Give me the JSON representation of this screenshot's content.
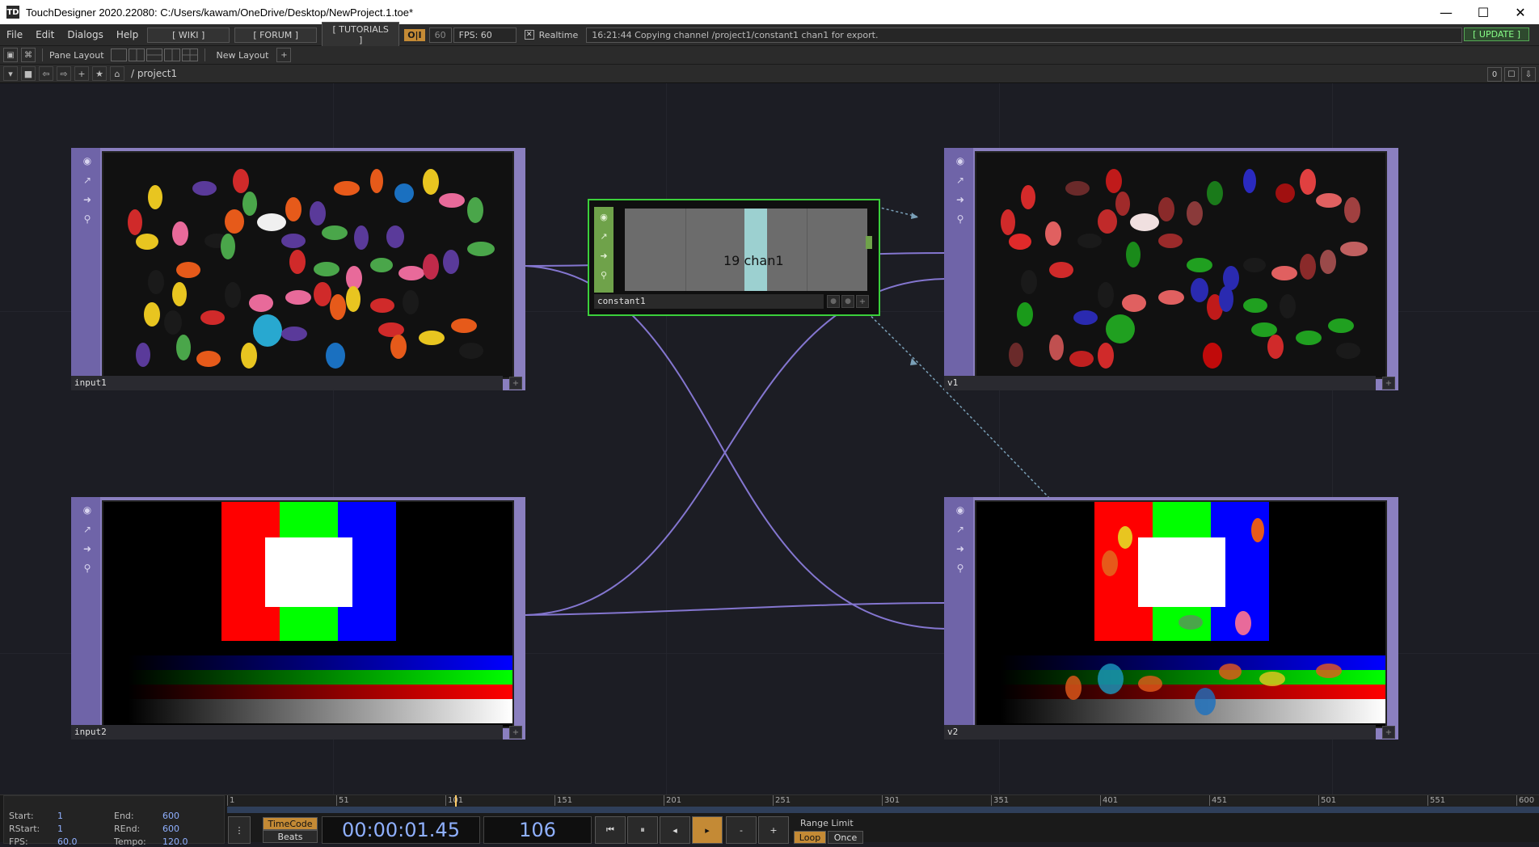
{
  "window": {
    "title": "TouchDesigner 2020.22080: C:/Users/kawam/OneDrive/Desktop/NewProject.1.toe*",
    "app_icon_text": "TD",
    "controls": {
      "minimize": "—",
      "maximize": "☐",
      "close": "✕"
    }
  },
  "menu": {
    "items": [
      "File",
      "Edit",
      "Dialogs",
      "Help"
    ],
    "wiki": "[ WIKI ]",
    "forum": "[ FORUM ]",
    "tutorials": "[ TUTORIALS ]",
    "oi": "O|I",
    "fps_limit": "60",
    "fps": "FPS: 60",
    "realtime_check": "✕",
    "realtime": "Realtime",
    "status": "16:21:44 Copying channel /project1/constant1 chan1 for export.",
    "update": "[ UPDATE ]"
  },
  "toolbar": {
    "pane_layout": "Pane Layout",
    "new_layout": "New Layout",
    "add": "+"
  },
  "pathbar": {
    "path": "/ project1",
    "counter": "0"
  },
  "nodes": {
    "input1": {
      "label": "input1"
    },
    "input2": {
      "label": "input2"
    },
    "v1": {
      "label": "v1"
    },
    "v2": {
      "label": "v2"
    },
    "constant1": {
      "label": "constant1",
      "value": "19",
      "channel": "chan1"
    }
  },
  "timeline": {
    "start_label": "Start:",
    "start": "1",
    "end_label": "End:",
    "end": "600",
    "rstart_label": "RStart:",
    "rstart": "1",
    "rend_label": "REnd:",
    "rend": "600",
    "fps_label": "FPS:",
    "fps": "60.0",
    "tempo_label": "Tempo:",
    "tempo": "120.0",
    "ticks": [
      "1",
      "51",
      "101",
      "151",
      "201",
      "251",
      "301",
      "351",
      "401",
      "451",
      "501",
      "551",
      "600"
    ],
    "timecode_btn": "TimeCode",
    "beats_btn": "Beats",
    "timecode": "00:00:01.45",
    "frame": "106",
    "range_limit": "Range Limit",
    "loop": "Loop",
    "once": "Once"
  },
  "colors": {
    "top_node": "#8a7fbf",
    "chop_node": "#6fa24a",
    "selection": "#3bd03b",
    "wire": "#8476d0"
  }
}
